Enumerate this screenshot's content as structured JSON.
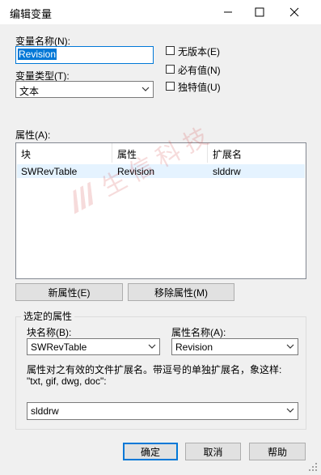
{
  "window": {
    "title": "编辑变量",
    "minimize_icon": "minimize-icon",
    "maximize_icon": "maximize-icon",
    "close_icon": "close-icon"
  },
  "variable_name": {
    "label": "变量名称(N):",
    "value": "Revision"
  },
  "variable_type": {
    "label": "变量类型(T):",
    "selected": "文本"
  },
  "options": {
    "no_version": "无版本(E)",
    "required_value": "必有值(N)",
    "unique_value": "独特值(U)"
  },
  "attributes": {
    "label": "属性(A):",
    "columns": [
      "块",
      "属性",
      "扩展名"
    ],
    "rows": [
      {
        "block": "SWRevTable",
        "attribute": "Revision",
        "extension": "slddrw"
      }
    ],
    "new_button": "新属性(E)",
    "remove_button": "移除属性(M)"
  },
  "selected_attribute": {
    "group_title": "选定的属性",
    "block_name_label": "块名称(B):",
    "block_name_value": "SWRevTable",
    "attr_name_label": "属性名称(A):",
    "attr_name_value": "Revision",
    "help_text": "属性对之有效的文件扩展名。带逗号的单独扩展名，象这样: \"txt, gif, dwg, doc\":",
    "extension_value": "slddrw"
  },
  "footer": {
    "ok": "确定",
    "cancel": "取消",
    "help": "帮助"
  },
  "watermark": {
    "text": "生信科技"
  },
  "colors": {
    "accent": "#0078d7",
    "dialog_bg": "#f0f0f0",
    "watermark": "#d33b3b"
  }
}
